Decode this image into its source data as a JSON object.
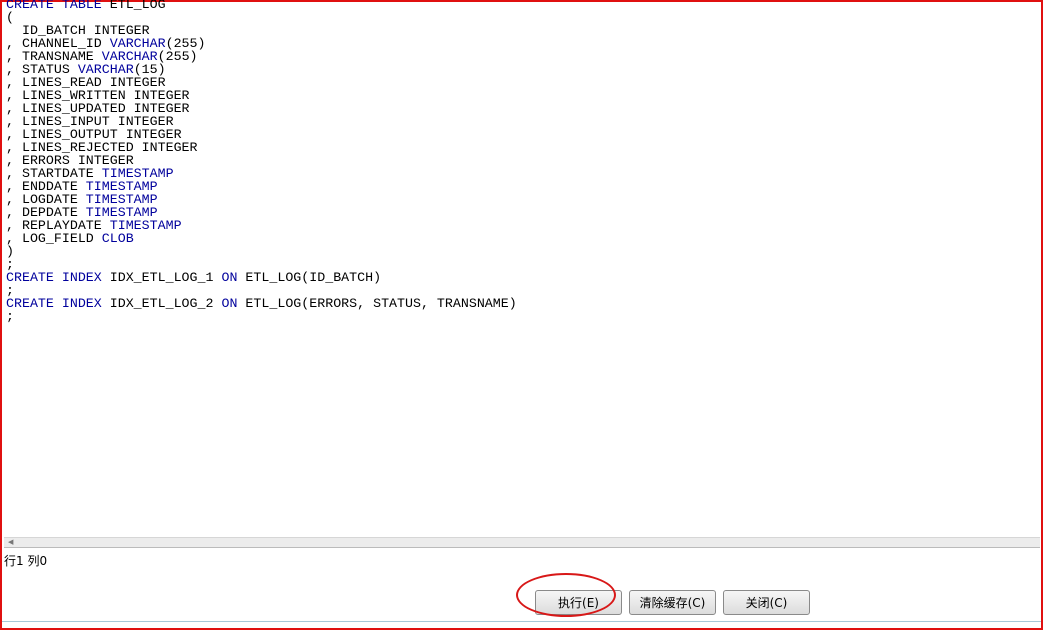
{
  "editor": {
    "lines": [
      [
        [
          "kw",
          "CREATE TABLE"
        ],
        [
          "t",
          " ETL_LOG"
        ]
      ],
      [
        [
          "t",
          "("
        ]
      ],
      [
        [
          "t",
          "  ID_BATCH INTEGER"
        ]
      ],
      [
        [
          "t",
          ", CHANNEL_ID "
        ],
        [
          "kw",
          "VARCHAR"
        ],
        [
          "t",
          "(255)"
        ]
      ],
      [
        [
          "t",
          ", TRANSNAME "
        ],
        [
          "kw",
          "VARCHAR"
        ],
        [
          "t",
          "(255)"
        ]
      ],
      [
        [
          "t",
          ", STATUS "
        ],
        [
          "kw",
          "VARCHAR"
        ],
        [
          "t",
          "(15)"
        ]
      ],
      [
        [
          "t",
          ", LINES_READ INTEGER"
        ]
      ],
      [
        [
          "t",
          ", LINES_WRITTEN INTEGER"
        ]
      ],
      [
        [
          "t",
          ", LINES_UPDATED INTEGER"
        ]
      ],
      [
        [
          "t",
          ", LINES_INPUT INTEGER"
        ]
      ],
      [
        [
          "t",
          ", LINES_OUTPUT INTEGER"
        ]
      ],
      [
        [
          "t",
          ", LINES_REJECTED INTEGER"
        ]
      ],
      [
        [
          "t",
          ", ERRORS INTEGER"
        ]
      ],
      [
        [
          "t",
          ", STARTDATE "
        ],
        [
          "kw",
          "TIMESTAMP"
        ]
      ],
      [
        [
          "t",
          ", ENDDATE "
        ],
        [
          "kw",
          "TIMESTAMP"
        ]
      ],
      [
        [
          "t",
          ", LOGDATE "
        ],
        [
          "kw",
          "TIMESTAMP"
        ]
      ],
      [
        [
          "t",
          ", DEPDATE "
        ],
        [
          "kw",
          "TIMESTAMP"
        ]
      ],
      [
        [
          "t",
          ", REPLAYDATE "
        ],
        [
          "kw",
          "TIMESTAMP"
        ]
      ],
      [
        [
          "t",
          ", LOG_FIELD "
        ],
        [
          "kw",
          "CLOB"
        ]
      ],
      [
        [
          "t",
          ")"
        ]
      ],
      [
        [
          "t",
          ";"
        ]
      ],
      [
        [
          "kw",
          "CREATE INDEX"
        ],
        [
          "t",
          " IDX_ETL_LOG_1 "
        ],
        [
          "kw",
          "ON"
        ],
        [
          "t",
          " ETL_LOG(ID_BATCH)"
        ]
      ],
      [
        [
          "t",
          ";"
        ]
      ],
      [
        [
          "kw",
          "CREATE INDEX"
        ],
        [
          "t",
          " IDX_ETL_LOG_2 "
        ],
        [
          "kw",
          "ON"
        ],
        [
          "t",
          " ETL_LOG(ERRORS, STATUS, TRANSNAME)"
        ]
      ],
      [
        [
          "t",
          ";"
        ]
      ]
    ],
    "keyword_color": "#00009c"
  },
  "status": {
    "position": "行1 列0"
  },
  "buttons": {
    "execute": "执行(E)",
    "clear_cache": "清除缓存(C)",
    "close": "关闭(C)"
  },
  "annotation_color": "#d81818"
}
